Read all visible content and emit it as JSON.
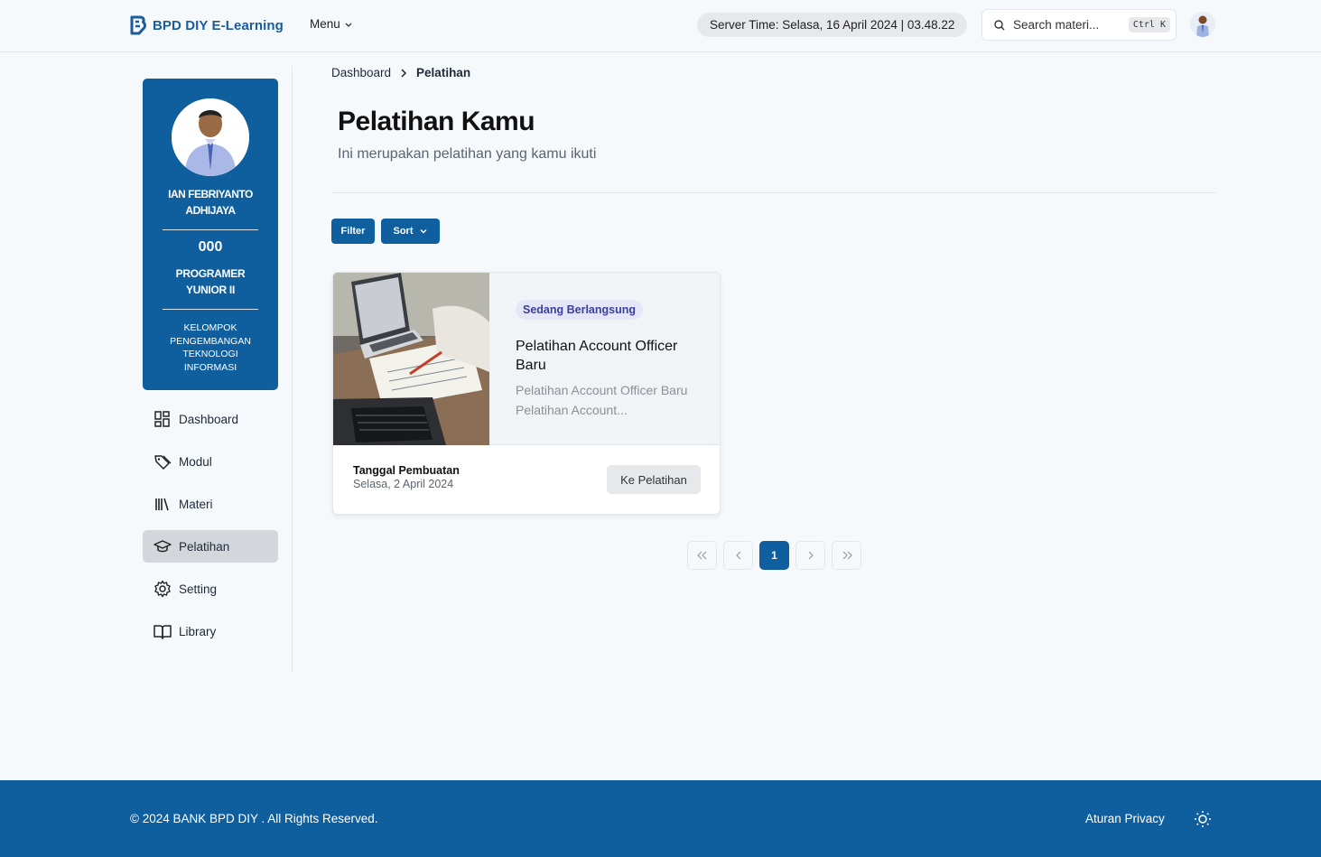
{
  "header": {
    "brand": "BPD DIY E-Learning",
    "menu_label": "Menu",
    "server_time": "Server Time: Selasa, 16 April 2024 | 03.48.22",
    "search_placeholder": "Search materi...",
    "search_shortcut": "Ctrl K"
  },
  "profile": {
    "name": "IAN FEBRIYANTO ADHIJAYA",
    "nip": "000",
    "job": "PROGRAMER YUNIOR II",
    "group": "KELOMPOK PENGEMBANGAN TEKNOLOGI INFORMASI"
  },
  "sidebar": {
    "items": [
      {
        "label": "Dashboard",
        "icon": "dashboard-icon",
        "active": false
      },
      {
        "label": "Modul",
        "icon": "tag-icon",
        "active": false
      },
      {
        "label": "Materi",
        "icon": "library-books-icon",
        "active": false
      },
      {
        "label": "Pelatihan",
        "icon": "graduation-cap-icon",
        "active": true
      },
      {
        "label": "Setting",
        "icon": "gear-icon",
        "active": false
      },
      {
        "label": "Library",
        "icon": "open-book-icon",
        "active": false
      }
    ]
  },
  "breadcrumb": {
    "items": [
      "Dashboard",
      "Pelatihan"
    ]
  },
  "page": {
    "title": "Pelatihan Kamu",
    "subtitle": "Ini merupakan pelatihan yang kamu ikuti"
  },
  "toolbar": {
    "filter_label": "Filter",
    "sort_label": "Sort"
  },
  "card": {
    "status": "Sedang Berlangsung",
    "title": "Pelatihan Account Officer Baru",
    "description": "Pelatihan Account Officer Baru Pelatihan Account...",
    "date_label": "Tanggal Pembuatan",
    "date": "Selasa, 2 April 2024",
    "button_label": "Ke Pelatihan"
  },
  "pagination": {
    "first": "«",
    "prev": "‹",
    "current": "1",
    "next": "›",
    "last": "»"
  },
  "footer": {
    "copyright": "© 2024 BANK BPD DIY . All Rights Reserved.",
    "privacy": "Aturan Privacy"
  },
  "colors": {
    "primary": "#0f5f9f",
    "badge_bg": "#e5e7f7",
    "badge_text": "#3c3f9c",
    "active_nav": "#d3d7dc"
  }
}
